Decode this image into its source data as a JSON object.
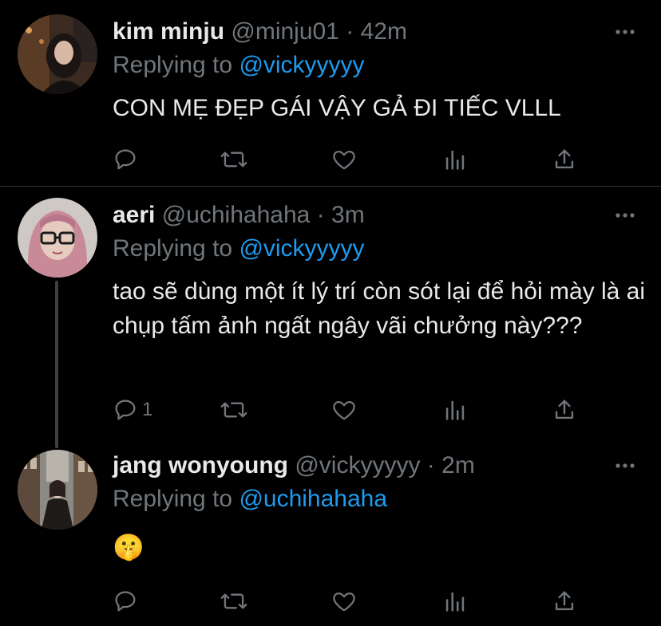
{
  "tweets": [
    {
      "name": "kim minju",
      "handle": "@minju01",
      "separator": "·",
      "time": "42m",
      "replying_prefix": "Replying to",
      "replying_to": "@vickyyyyy",
      "text": "CON MẸ ĐẸP GÁI VẬY GẢ ĐI TIẾC VLLL",
      "reply_count": ""
    },
    {
      "name": "aeri",
      "handle": "@uchihahaha",
      "separator": "·",
      "time": "3m",
      "replying_prefix": "Replying to",
      "replying_to": "@vickyyyyy",
      "text": "tao sẽ dùng một ít lý trí còn sót lại để hỏi mày là ai chụp tấm ảnh ngất ngây vãi chưởng này???",
      "reply_count": "1"
    },
    {
      "name": "jang wonyoung",
      "handle": "@vickyyyyy",
      "separator": "·",
      "time": "2m",
      "replying_prefix": "Replying to",
      "replying_to": "@uchihahaha",
      "text": "🤫",
      "reply_count": ""
    }
  ],
  "icons": [
    "reply-icon",
    "retweet-icon",
    "like-icon",
    "analytics-icon",
    "share-icon",
    "more-icon"
  ],
  "colors": {
    "background": "#000000",
    "text": "#e7e9ea",
    "muted": "#71767b",
    "accent": "#1d9bf0",
    "divider": "#2f3336"
  }
}
